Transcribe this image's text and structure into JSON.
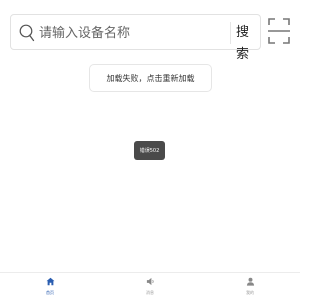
{
  "search": {
    "placeholder": "请输入设备名称",
    "button_label": "搜索"
  },
  "reload": {
    "label": "加载失败，点击重新加载"
  },
  "toast": {
    "text": "错误502"
  },
  "tabbar": {
    "tabs": [
      {
        "label": "首页",
        "icon": "home-icon",
        "active": true
      },
      {
        "label": "消息",
        "icon": "message-icon",
        "active": false
      },
      {
        "label": "我的",
        "icon": "user-icon",
        "active": false
      }
    ]
  },
  "colors": {
    "accent": "#2a5db0",
    "inactive": "#999999",
    "toast_bg": "#4a4a4a"
  }
}
